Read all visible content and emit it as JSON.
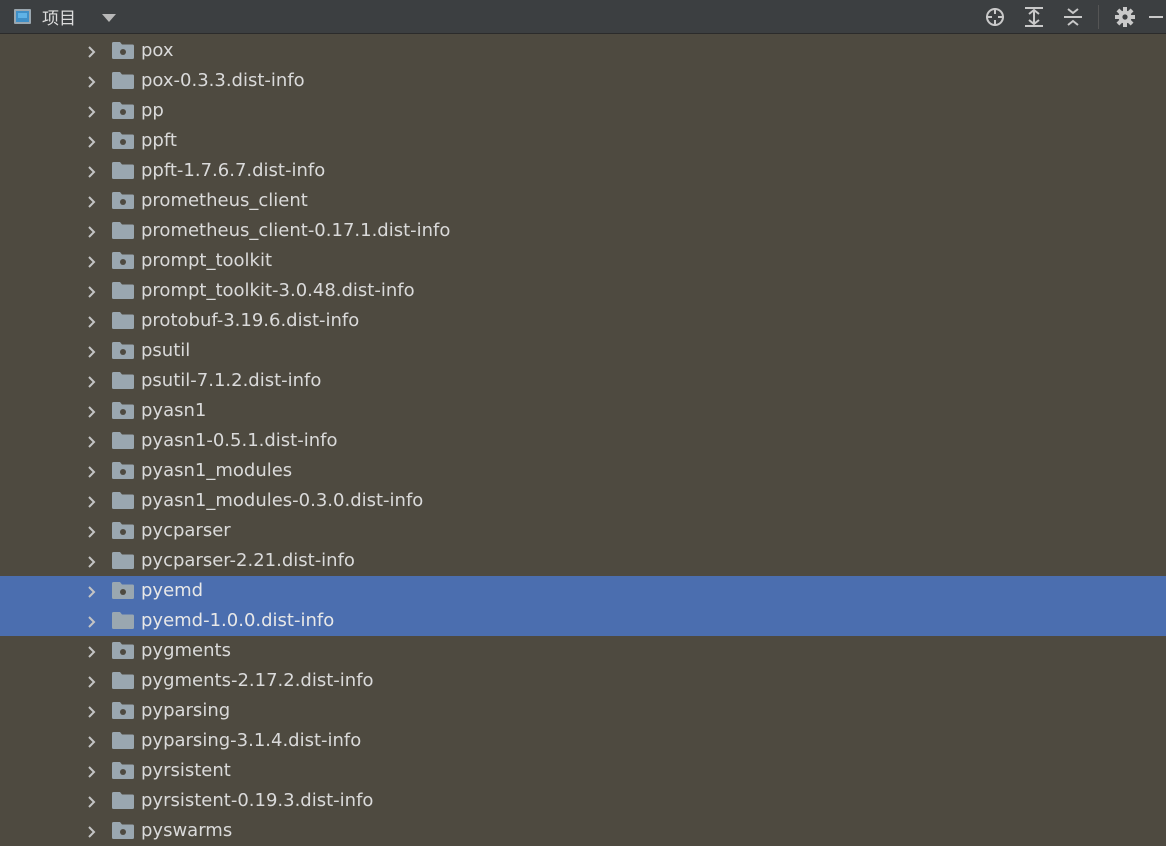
{
  "toolbar": {
    "title": "项目",
    "icons": [
      "locate-icon",
      "expand-all-icon",
      "collapse-all-icon",
      "gear-icon",
      "minimize-icon"
    ]
  },
  "colors": {
    "background": "#4e4a40",
    "toolbar": "#3c3f41",
    "selection": "#4b6eaf",
    "folder": "#9aa7b0"
  },
  "tree": {
    "items": [
      {
        "label": "pox",
        "type": "package"
      },
      {
        "label": "pox-0.3.3.dist-info",
        "type": "folder"
      },
      {
        "label": "pp",
        "type": "package"
      },
      {
        "label": "ppft",
        "type": "package"
      },
      {
        "label": "ppft-1.7.6.7.dist-info",
        "type": "folder"
      },
      {
        "label": "prometheus_client",
        "type": "package"
      },
      {
        "label": "prometheus_client-0.17.1.dist-info",
        "type": "folder"
      },
      {
        "label": "prompt_toolkit",
        "type": "package"
      },
      {
        "label": "prompt_toolkit-3.0.48.dist-info",
        "type": "folder"
      },
      {
        "label": "protobuf-3.19.6.dist-info",
        "type": "folder"
      },
      {
        "label": "psutil",
        "type": "package"
      },
      {
        "label": "psutil-7.1.2.dist-info",
        "type": "folder"
      },
      {
        "label": "pyasn1",
        "type": "package"
      },
      {
        "label": "pyasn1-0.5.1.dist-info",
        "type": "folder"
      },
      {
        "label": "pyasn1_modules",
        "type": "package"
      },
      {
        "label": "pyasn1_modules-0.3.0.dist-info",
        "type": "folder"
      },
      {
        "label": "pycparser",
        "type": "package"
      },
      {
        "label": "pycparser-2.21.dist-info",
        "type": "folder"
      },
      {
        "label": "pyemd",
        "type": "package",
        "selected": true
      },
      {
        "label": "pyemd-1.0.0.dist-info",
        "type": "folder",
        "selected": true
      },
      {
        "label": "pygments",
        "type": "package"
      },
      {
        "label": "pygments-2.17.2.dist-info",
        "type": "folder"
      },
      {
        "label": "pyparsing",
        "type": "package"
      },
      {
        "label": "pyparsing-3.1.4.dist-info",
        "type": "folder"
      },
      {
        "label": "pyrsistent",
        "type": "package"
      },
      {
        "label": "pyrsistent-0.19.3.dist-info",
        "type": "folder"
      },
      {
        "label": "pyswarms",
        "type": "package"
      }
    ]
  }
}
